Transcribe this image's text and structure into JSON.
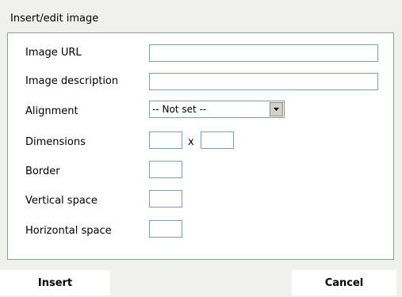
{
  "dialog": {
    "title": "Insert/edit image"
  },
  "form": {
    "image_url": {
      "label": "Image URL",
      "value": ""
    },
    "image_description": {
      "label": "Image description",
      "value": ""
    },
    "alignment": {
      "label": "Alignment",
      "selected": "-- Not set --"
    },
    "dimensions": {
      "label": "Dimensions",
      "width": "",
      "height": "",
      "separator": "x"
    },
    "border": {
      "label": "Border",
      "value": ""
    },
    "vertical_space": {
      "label": "Vertical space",
      "value": ""
    },
    "horizontal_space": {
      "label": "Horizontal space",
      "value": ""
    }
  },
  "footer": {
    "insert_label": "Insert",
    "cancel_label": "Cancel"
  },
  "icons": {
    "select_arrow": "chevron-down-icon"
  }
}
